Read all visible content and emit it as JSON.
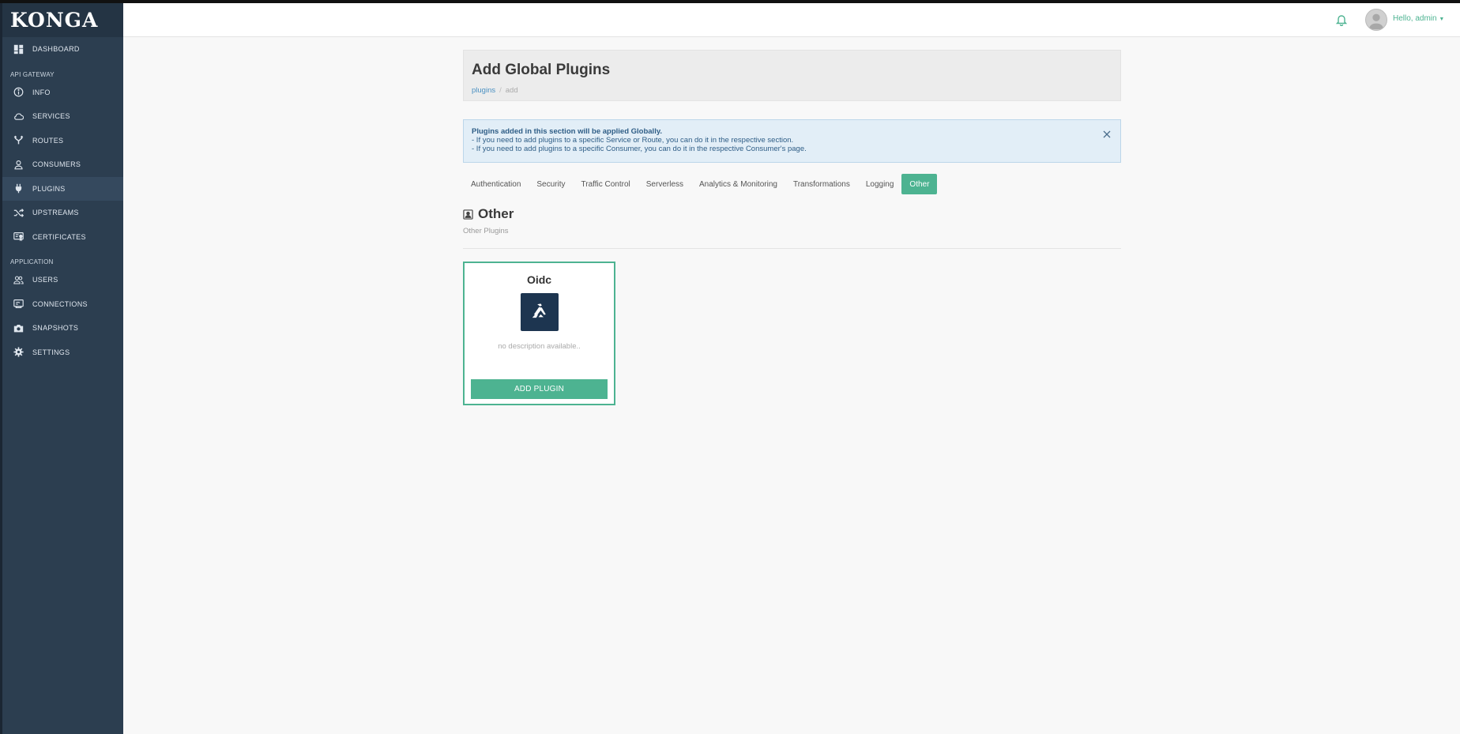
{
  "app": {
    "logo": "KONGA"
  },
  "sidebar": {
    "items_top": [
      {
        "label": "DASHBOARD",
        "icon": "dashboard-icon"
      }
    ],
    "sections": [
      {
        "title": "API GATEWAY",
        "items": [
          {
            "label": "INFO",
            "icon": "info-icon"
          },
          {
            "label": "SERVICES",
            "icon": "cloud-icon"
          },
          {
            "label": "ROUTES",
            "icon": "routes-icon"
          },
          {
            "label": "CONSUMERS",
            "icon": "user-icon"
          },
          {
            "label": "PLUGINS",
            "icon": "plug-icon",
            "active": true
          },
          {
            "label": "UPSTREAMS",
            "icon": "shuffle-icon"
          },
          {
            "label": "CERTIFICATES",
            "icon": "certificate-icon"
          }
        ]
      },
      {
        "title": "APPLICATION",
        "items": [
          {
            "label": "USERS",
            "icon": "users-icon"
          },
          {
            "label": "CONNECTIONS",
            "icon": "connections-icon"
          },
          {
            "label": "SNAPSHOTS",
            "icon": "camera-icon"
          },
          {
            "label": "SETTINGS",
            "icon": "gear-icon"
          }
        ]
      }
    ]
  },
  "topbar": {
    "greeting": "Hello, admin",
    "bell_icon": "bell-icon",
    "avatar_icon": "avatar-icon"
  },
  "header": {
    "title": "Add Global Plugins",
    "breadcrumb": {
      "link": "plugins",
      "separator": "/",
      "current": "add"
    }
  },
  "alert": {
    "title": "Plugins added in this section will be applied Globally.",
    "line1": "- If you need to add plugins to a specific Service or Route, you can do it in the respective section.",
    "line2": "- If you need to add plugins to a specific Consumer, you can do it in the respective Consumer's page."
  },
  "tabs": [
    {
      "label": "Authentication"
    },
    {
      "label": "Security"
    },
    {
      "label": "Traffic Control"
    },
    {
      "label": "Serverless"
    },
    {
      "label": "Analytics & Monitoring"
    },
    {
      "label": "Transformations"
    },
    {
      "label": "Logging"
    },
    {
      "label": "Other",
      "active": true
    }
  ],
  "section": {
    "title": "Other",
    "subtitle": "Other Plugins"
  },
  "plugins": [
    {
      "name": "Oidc",
      "description": "no description available..",
      "button": "ADD PLUGIN"
    }
  ],
  "colors": {
    "accent": "#4db391",
    "sidebar": "#2c3e50",
    "link": "#4a90c2"
  }
}
